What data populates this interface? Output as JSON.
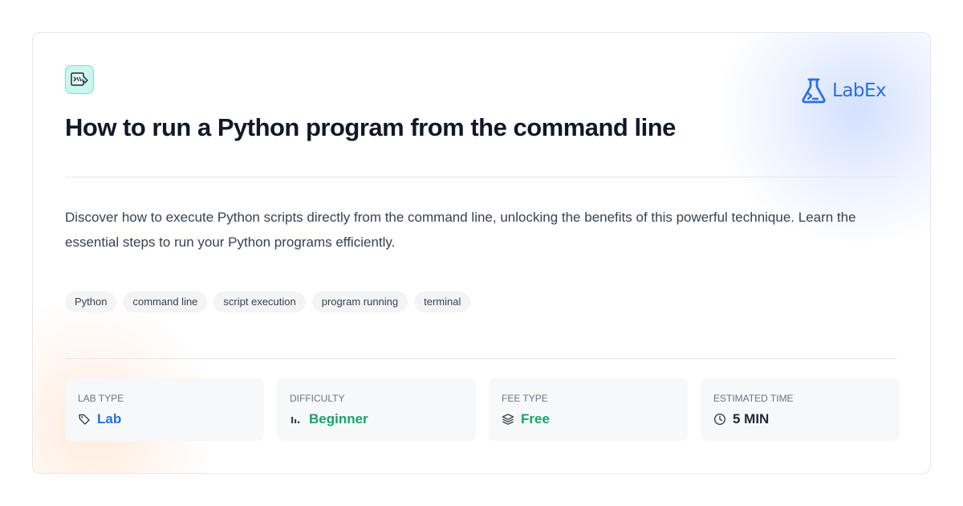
{
  "brand": {
    "name": "LabEx",
    "color": "#2b6fe0",
    "logo_icon": "flask-terminal-icon"
  },
  "lab_icon": "code-editor-icon",
  "title": "How to run a Python program from the command line",
  "description": "Discover how to execute Python scripts directly from the command line, unlocking the benefits of this powerful technique. Learn the essential steps to run your Python programs efficiently.",
  "tags": [
    "Python",
    "command line",
    "script execution",
    "program running",
    "terminal"
  ],
  "stats": {
    "lab_type": {
      "label": "LAB TYPE",
      "value": "Lab",
      "icon": "tag-icon",
      "color": "#2b6fe0"
    },
    "difficulty": {
      "label": "DIFFICULTY",
      "value": "Beginner",
      "icon": "bar-chart-icon",
      "color": "#16a36a"
    },
    "fee_type": {
      "label": "FEE TYPE",
      "value": "Free",
      "icon": "layers-icon",
      "color": "#16a36a"
    },
    "estimated_time": {
      "label": "ESTIMATED TIME",
      "value": "5 MIN",
      "icon": "clock-icon",
      "color": "#1f2937"
    }
  }
}
